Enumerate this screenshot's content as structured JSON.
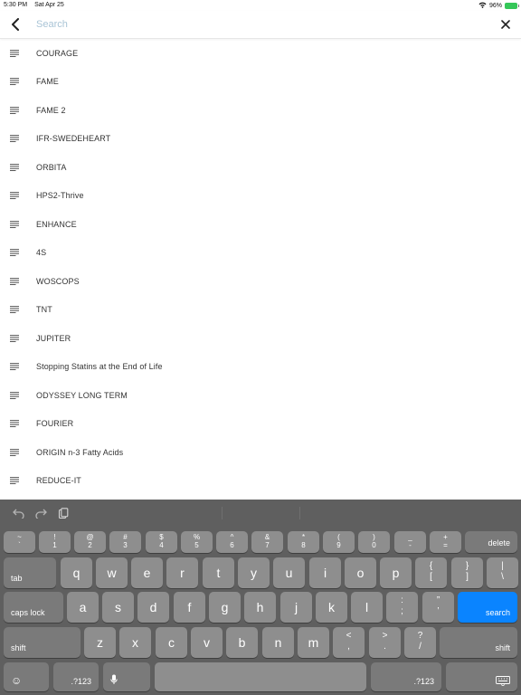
{
  "status": {
    "time": "5:30 PM",
    "date": "Sat Apr 25",
    "battery": "96%"
  },
  "search": {
    "placeholder": "Search",
    "value": ""
  },
  "items": [
    "COURAGE",
    "FAME",
    "FAME 2",
    "IFR-SWEDEHEART",
    "ORBITA",
    "HPS2-Thrive",
    "ENHANCE",
    "4S",
    "WOSCOPS",
    "TNT",
    "JUPITER",
    "Stopping Statins at the End of Life",
    "ODYSSEY LONG TERM",
    "FOURIER",
    "ORIGIN n-3 Fatty Acids",
    "REDUCE-IT"
  ],
  "keyboard": {
    "numrow": [
      [
        "~",
        "`"
      ],
      [
        "!",
        "1"
      ],
      [
        "@",
        "2"
      ],
      [
        "#",
        "3"
      ],
      [
        "$",
        "4"
      ],
      [
        "%",
        "5"
      ],
      [
        "^",
        "6"
      ],
      [
        "&",
        "7"
      ],
      [
        "*",
        "8"
      ],
      [
        "(",
        "9"
      ],
      [
        ")",
        "0"
      ],
      [
        "_",
        "-"
      ],
      [
        "+",
        "="
      ]
    ],
    "row2": [
      "q",
      "w",
      "e",
      "r",
      "t",
      "y",
      "u",
      "i",
      "o",
      "p"
    ],
    "row2_punct": [
      [
        "{",
        "["
      ],
      [
        "}",
        "]"
      ],
      [
        "|",
        "\\"
      ]
    ],
    "row3": [
      "a",
      "s",
      "d",
      "f",
      "g",
      "h",
      "j",
      "k",
      "l"
    ],
    "row3_punct": [
      [
        ":",
        ";"
      ],
      [
        "”",
        "’"
      ]
    ],
    "row4": [
      "z",
      "x",
      "c",
      "v",
      "b",
      "n",
      "m"
    ],
    "row4_punct": [
      [
        "<",
        ","
      ],
      [
        ">",
        "."
      ],
      [
        "?",
        "/"
      ]
    ],
    "delete": "delete",
    "tab": "tab",
    "caps_lock": "caps lock",
    "search": "search",
    "shift": "shift",
    "numbers": ".?123",
    "emoji": "☺"
  },
  "colors": {
    "accent": "#0a84ff",
    "keyboard_bg": "#5f5f5f",
    "key_bg": "#8e8e8e"
  }
}
